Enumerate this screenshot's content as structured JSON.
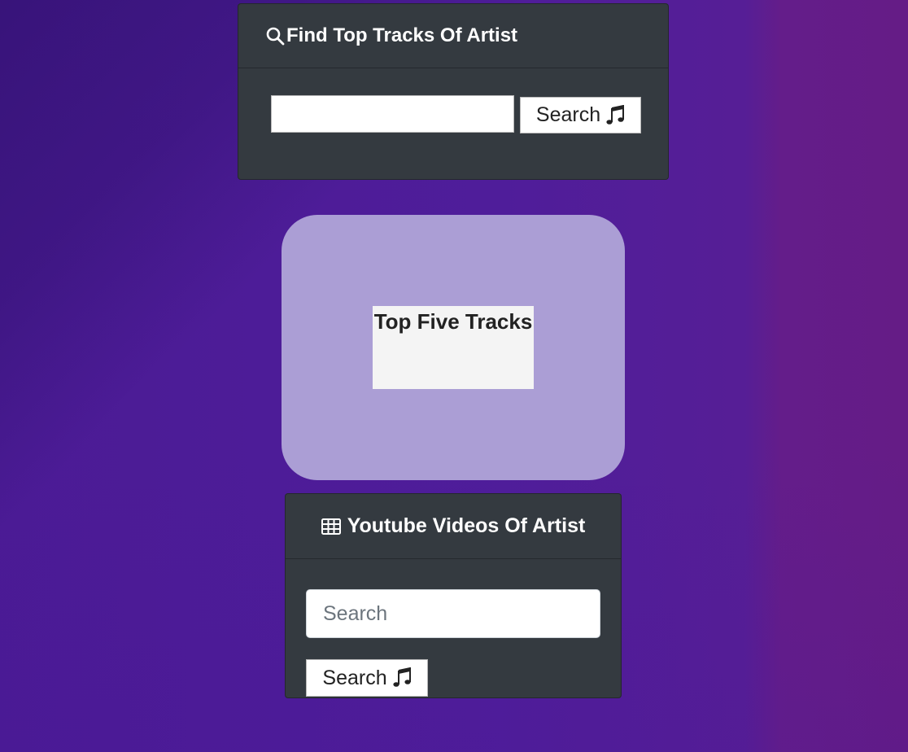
{
  "find_tracks": {
    "title": "Find Top Tracks Of Artist",
    "icon": "search-icon",
    "input_value": "",
    "input_placeholder": "",
    "button_label": "Search",
    "button_icon": "music-note-icon"
  },
  "top_five": {
    "title": "Top Five Tracks"
  },
  "youtube": {
    "title": "Youtube Videos Of Artist",
    "icon": "table-icon",
    "input_value": "",
    "input_placeholder": "Search",
    "button_label": "Search",
    "button_icon": "music-note-icon"
  },
  "colors": {
    "card_background": "#343a40",
    "panel_background": "#ab9ed5",
    "page_background": "#4f1d9a"
  }
}
